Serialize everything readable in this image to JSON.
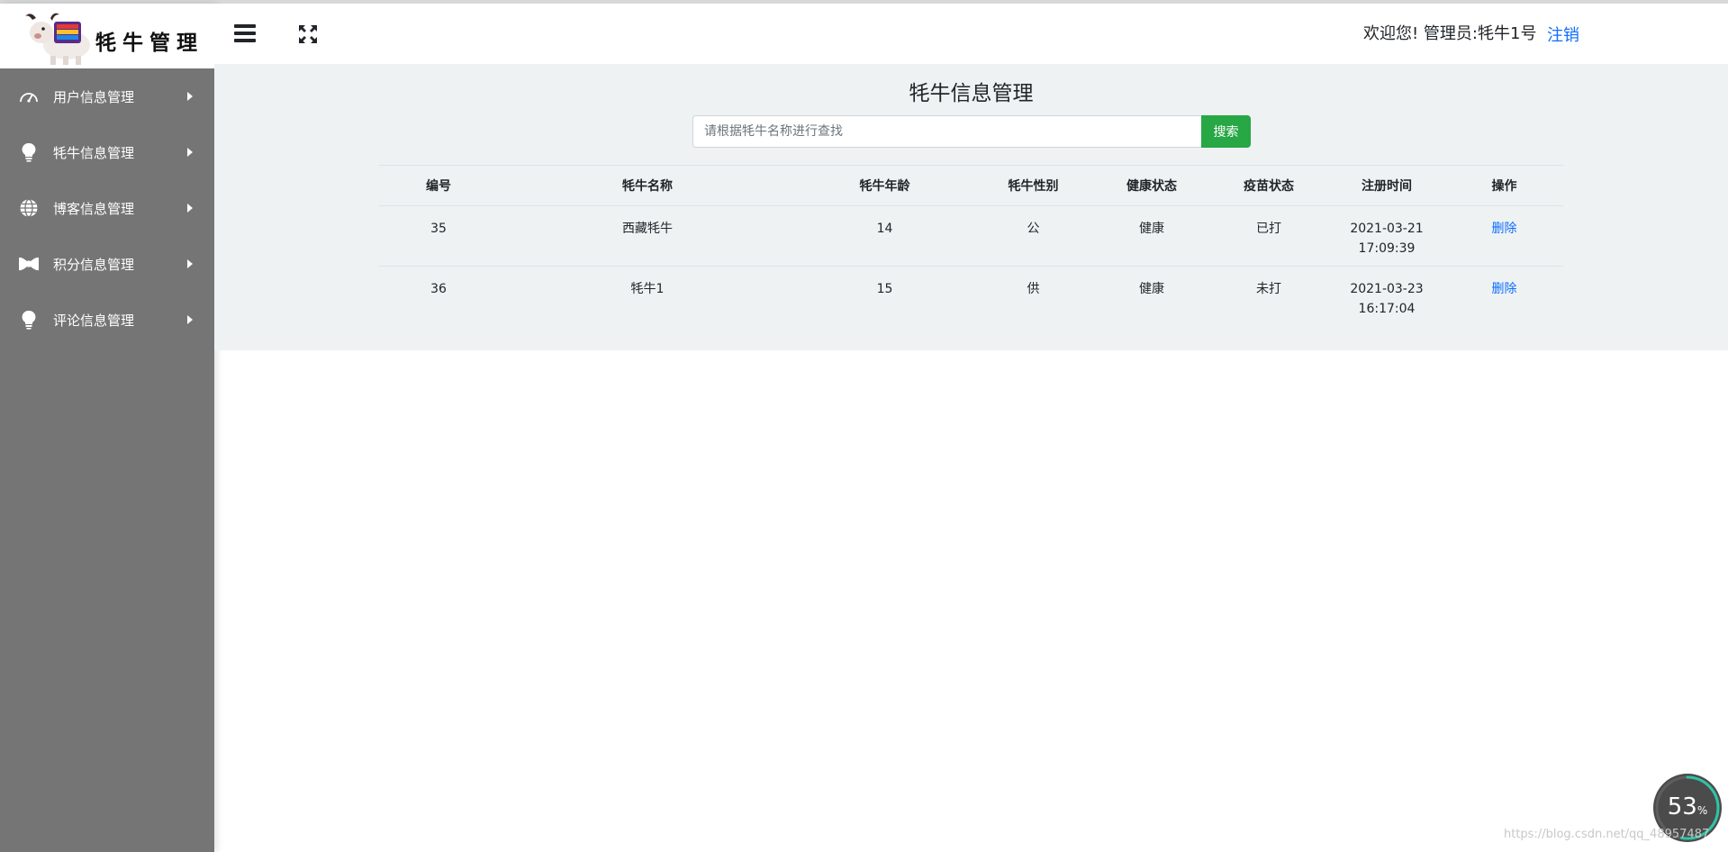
{
  "logo": {
    "text": "牦牛管理"
  },
  "sidebar": {
    "items": [
      {
        "label": "用户信息管理",
        "icon": "dashboard-icon"
      },
      {
        "label": "牦牛信息管理",
        "icon": "lightbulb-icon"
      },
      {
        "label": "博客信息管理",
        "icon": "globe-icon"
      },
      {
        "label": "积分信息管理",
        "icon": "bowtie-icon"
      },
      {
        "label": "评论信息管理",
        "icon": "lightbulb-icon"
      }
    ]
  },
  "header": {
    "welcome": "欢迎您!  管理员:牦牛1号",
    "logout": "注销"
  },
  "main": {
    "title": "牦牛信息管理",
    "search": {
      "placeholder": "请根据牦牛名称进行查找",
      "button": "搜索"
    },
    "table": {
      "headers": [
        "编号",
        "牦牛名称",
        "牦牛年龄",
        "牦牛性别",
        "健康状态",
        "疫苗状态",
        "注册时间",
        "操作"
      ],
      "rows": [
        {
          "id": "35",
          "name": "西藏牦牛",
          "age": "14",
          "sex": "公",
          "health": "健康",
          "vaccine": "已打",
          "date": "2021-03-21",
          "time": "17:09:39",
          "action": "删除"
        },
        {
          "id": "36",
          "name": "牦牛1",
          "age": "15",
          "sex": "供",
          "health": "健康",
          "vaccine": "未打",
          "date": "2021-03-23",
          "time": "16:17:04",
          "action": "删除"
        }
      ]
    }
  },
  "progress": {
    "value": "53",
    "unit": "%",
    "fraction": 0.53
  },
  "watermark": "https://blog.csdn.net/qq_48957487",
  "colors": {
    "sidebar": "#757575",
    "panel": "#eef2f3",
    "search_button": "#28a745",
    "link": "#0d6efd"
  }
}
